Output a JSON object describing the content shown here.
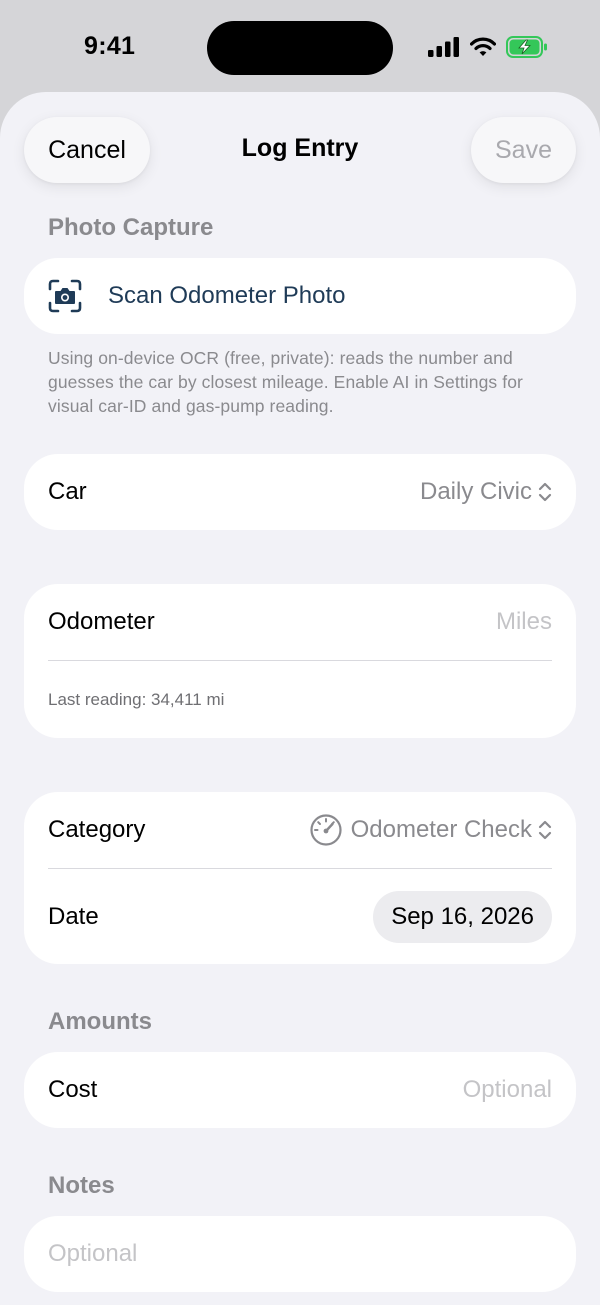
{
  "status_bar": {
    "time": "9:41"
  },
  "nav": {
    "cancel_label": "Cancel",
    "title": "Log Entry",
    "save_label": "Save"
  },
  "photo_capture": {
    "header": "Photo Capture",
    "scan_label": "Scan Odometer Photo",
    "scan_icon": "camera-viewfinder-icon",
    "footnote": "Using on-device OCR (free, private): reads the number and guesses the car by closest mileage. Enable AI in Settings for visual car-ID and gas-pump reading."
  },
  "car": {
    "label": "Car",
    "value": "Daily Civic"
  },
  "odometer": {
    "label": "Odometer",
    "placeholder": "Miles",
    "last_reading": "Last reading: 34,411 mi"
  },
  "category": {
    "label": "Category",
    "value": "Odometer Check",
    "icon": "gauge-icon"
  },
  "date": {
    "label": "Date",
    "value": "Sep 16, 2026"
  },
  "amounts": {
    "header": "Amounts",
    "cost_label": "Cost",
    "cost_placeholder": "Optional"
  },
  "notes": {
    "header": "Notes",
    "placeholder": "Optional"
  },
  "colors": {
    "accent": "#1f3b57",
    "battery_green": "#34c759",
    "sheet_background": "#f2f2f7",
    "secondary_text": "#8a8a8e"
  }
}
